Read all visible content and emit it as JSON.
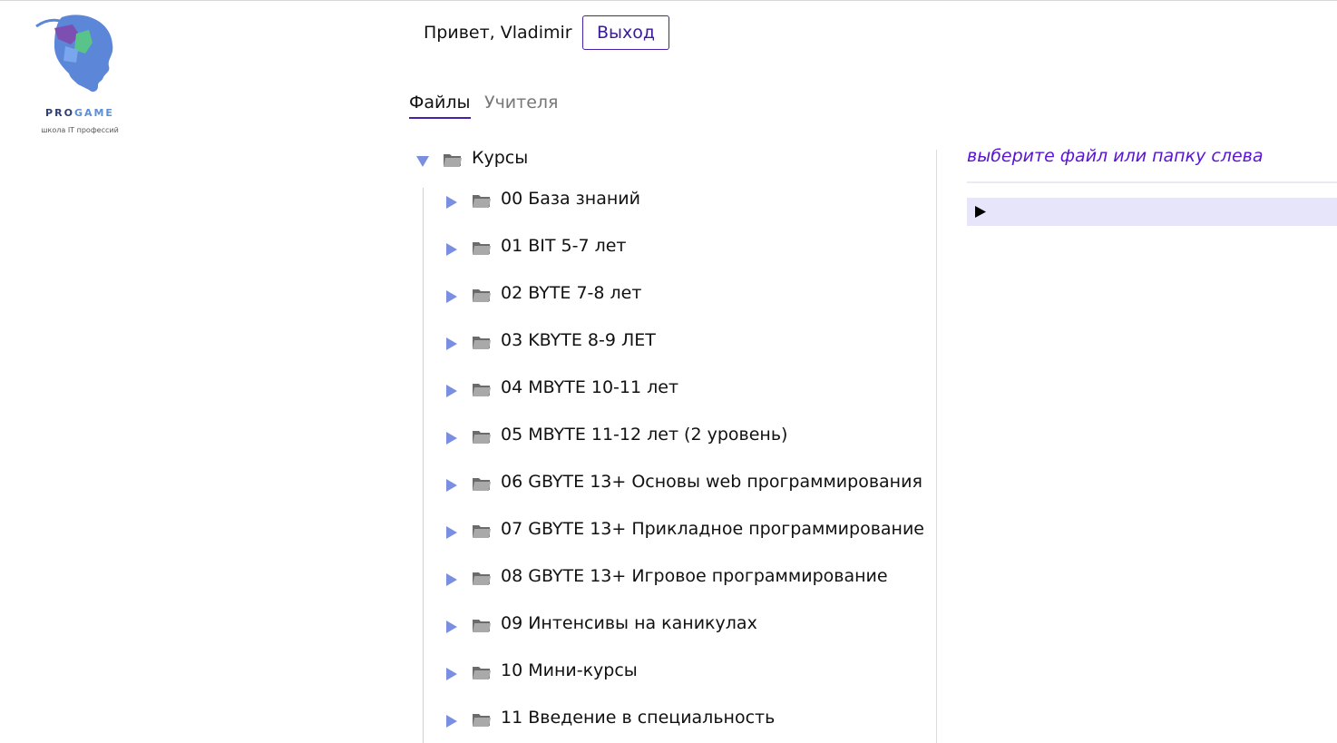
{
  "brand": {
    "name_part1": "PRO",
    "name_part2": "GAME",
    "tagline": "школа IT профессий"
  },
  "header": {
    "greeting": "Привет, Vladimir",
    "logout_label": "Выход"
  },
  "tabs": [
    {
      "label": "Файлы",
      "active": true
    },
    {
      "label": "Учителя",
      "active": false
    }
  ],
  "tree": {
    "root": {
      "label": "Курсы",
      "expanded": true
    },
    "items": [
      {
        "label": "00 База знаний"
      },
      {
        "label": "01 BIT 5-7 лет"
      },
      {
        "label": "02 BYTE 7-8 лет"
      },
      {
        "label": "03 KBYTE 8-9 ЛЕТ"
      },
      {
        "label": "04 MBYTE 10-11 лет"
      },
      {
        "label": "05 MBYTE 11-12 лет (2 уровень)"
      },
      {
        "label": "06 GBYTE 13+ Основы web программирования"
      },
      {
        "label": "07 GBYTE 13+ Прикладное программирование"
      },
      {
        "label": "08 GBYTE 13+ Игровое программирование"
      },
      {
        "label": "09 Интенсивы на каникулах"
      },
      {
        "label": "10 Мини-курсы"
      },
      {
        "label": "11 Введение в специальность"
      }
    ]
  },
  "preview": {
    "hint": "выберите файл или папку слева"
  },
  "colors": {
    "accent": "#4a1fa8",
    "hint": "#5a13d6",
    "toggle": "#7b8fe0",
    "details_bg": "#e7e5fa"
  }
}
